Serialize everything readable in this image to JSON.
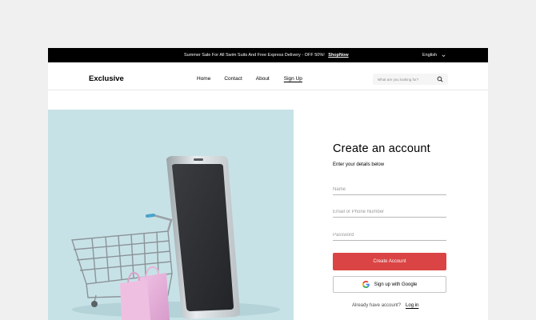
{
  "topbar": {
    "promo_text": "Summer Sale For All Swim Suits And Free Express Delivery - OFF 50%!",
    "promo_link": "ShopNow",
    "language": "English"
  },
  "header": {
    "logo": "Exclusive",
    "nav": [
      {
        "label": "Home"
      },
      {
        "label": "Contact"
      },
      {
        "label": "About"
      },
      {
        "label": "Sign Up",
        "active": true
      }
    ],
    "search_placeholder": "What are you looking for?"
  },
  "form": {
    "title": "Create an account",
    "subtitle": "Enter your details below",
    "name_placeholder": "Name",
    "email_placeholder": "Email or Phone Number",
    "password_placeholder": "Password",
    "create_button": "Create Account",
    "google_button": "Sign up with Google",
    "have_account": "Already have account?",
    "login_link": "Log in"
  },
  "colors": {
    "accent": "#DB4444",
    "topbar_bg": "#000000",
    "hero_bg": "#C7E2E6",
    "search_bg": "#F5F5F5"
  },
  "icons": {
    "language": "chevron-down-icon",
    "search": "search-icon",
    "google": "google-icon"
  }
}
